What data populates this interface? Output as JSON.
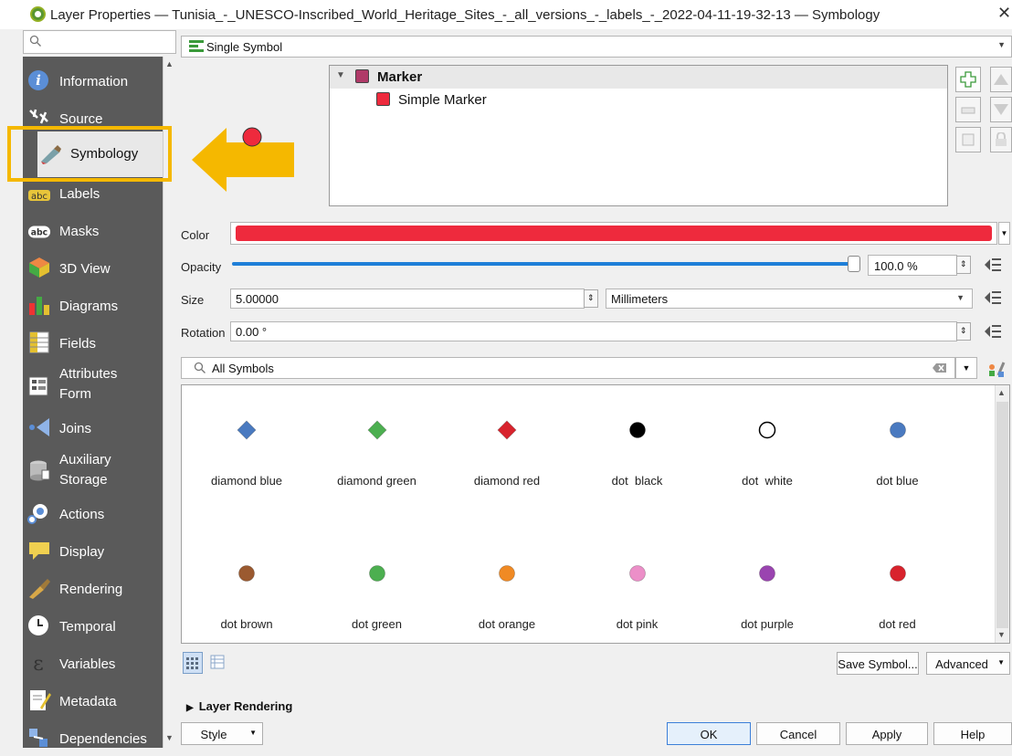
{
  "window": {
    "title": "Layer Properties — Tunisia_-_UNESCO-Inscribed_World_Heritage_Sites_-_all_versions_-_labels_-_2022-04-11-19-32-13 — Symbology",
    "close_glyph": "✕"
  },
  "sidebar": {
    "items": [
      {
        "label": "Information",
        "icon": "info-icon"
      },
      {
        "label": "Source",
        "icon": "source-icon"
      },
      {
        "label": "Symbology",
        "icon": "paintbrush-icon"
      },
      {
        "label": "Labels",
        "icon": "labels-icon"
      },
      {
        "label": "Masks",
        "icon": "masks-icon"
      },
      {
        "label": "3D View",
        "icon": "cube-icon"
      },
      {
        "label": "Diagrams",
        "icon": "diagrams-icon"
      },
      {
        "label": "Fields",
        "icon": "fields-icon"
      },
      {
        "label": "Attributes\nForm",
        "icon": "form-icon"
      },
      {
        "label": "Joins",
        "icon": "joins-icon"
      },
      {
        "label": "Auxiliary\nStorage",
        "icon": "storage-icon"
      },
      {
        "label": "Actions",
        "icon": "actions-icon"
      },
      {
        "label": "Display",
        "icon": "display-icon"
      },
      {
        "label": "Rendering",
        "icon": "rendering-icon"
      },
      {
        "label": "Temporal",
        "icon": "clock-icon"
      },
      {
        "label": "Variables",
        "icon": "variables-icon"
      },
      {
        "label": "Metadata",
        "icon": "metadata-icon"
      },
      {
        "label": "Dependencies",
        "icon": "dependencies-icon"
      }
    ],
    "selected": "Symbology"
  },
  "renderer": {
    "value": "Single Symbol"
  },
  "tree": {
    "root_label": "Marker",
    "child_label": "Simple Marker"
  },
  "properties": {
    "color_label": "Color",
    "color_value": "#ee2a3d",
    "opacity_label": "Opacity",
    "opacity_value": "100.0 %",
    "opacity_fraction": 1.0,
    "size_label": "Size",
    "size_value": "5.00000",
    "size_unit": "Millimeters",
    "rotation_label": "Rotation",
    "rotation_value": "0.00 °"
  },
  "symbol_search": {
    "value": "All Symbols"
  },
  "symbols": [
    {
      "name": "diamond blue",
      "shape": "diamond",
      "color": "#4a7ac0"
    },
    {
      "name": "diamond green",
      "shape": "diamond",
      "color": "#4caf50"
    },
    {
      "name": "diamond red",
      "shape": "diamond",
      "color": "#d8232d"
    },
    {
      "name": "dot  black",
      "shape": "dot",
      "color": "#000000"
    },
    {
      "name": "dot  white",
      "shape": "dot",
      "color": "#ffffff"
    },
    {
      "name": "dot blue",
      "shape": "dot",
      "color": "#4a7ac0"
    },
    {
      "name": "dot brown",
      "shape": "dot",
      "color": "#9b5a30"
    },
    {
      "name": "dot green",
      "shape": "dot",
      "color": "#4caf50"
    },
    {
      "name": "dot orange",
      "shape": "dot",
      "color": "#f08a24"
    },
    {
      "name": "dot pink",
      "shape": "dot",
      "color": "#ec8fc8"
    },
    {
      "name": "dot purple",
      "shape": "dot",
      "color": "#9a44b0"
    },
    {
      "name": "dot red",
      "shape": "dot",
      "color": "#d8232d"
    }
  ],
  "buttons": {
    "save_symbol": "Save Symbol...",
    "advanced": "Advanced",
    "layer_rendering": "Layer Rendering",
    "style": "Style",
    "ok": "OK",
    "cancel": "Cancel",
    "apply": "Apply",
    "help": "Help"
  },
  "accent": {
    "highlight": "#f5b800",
    "slider": "#1f7fd8"
  }
}
